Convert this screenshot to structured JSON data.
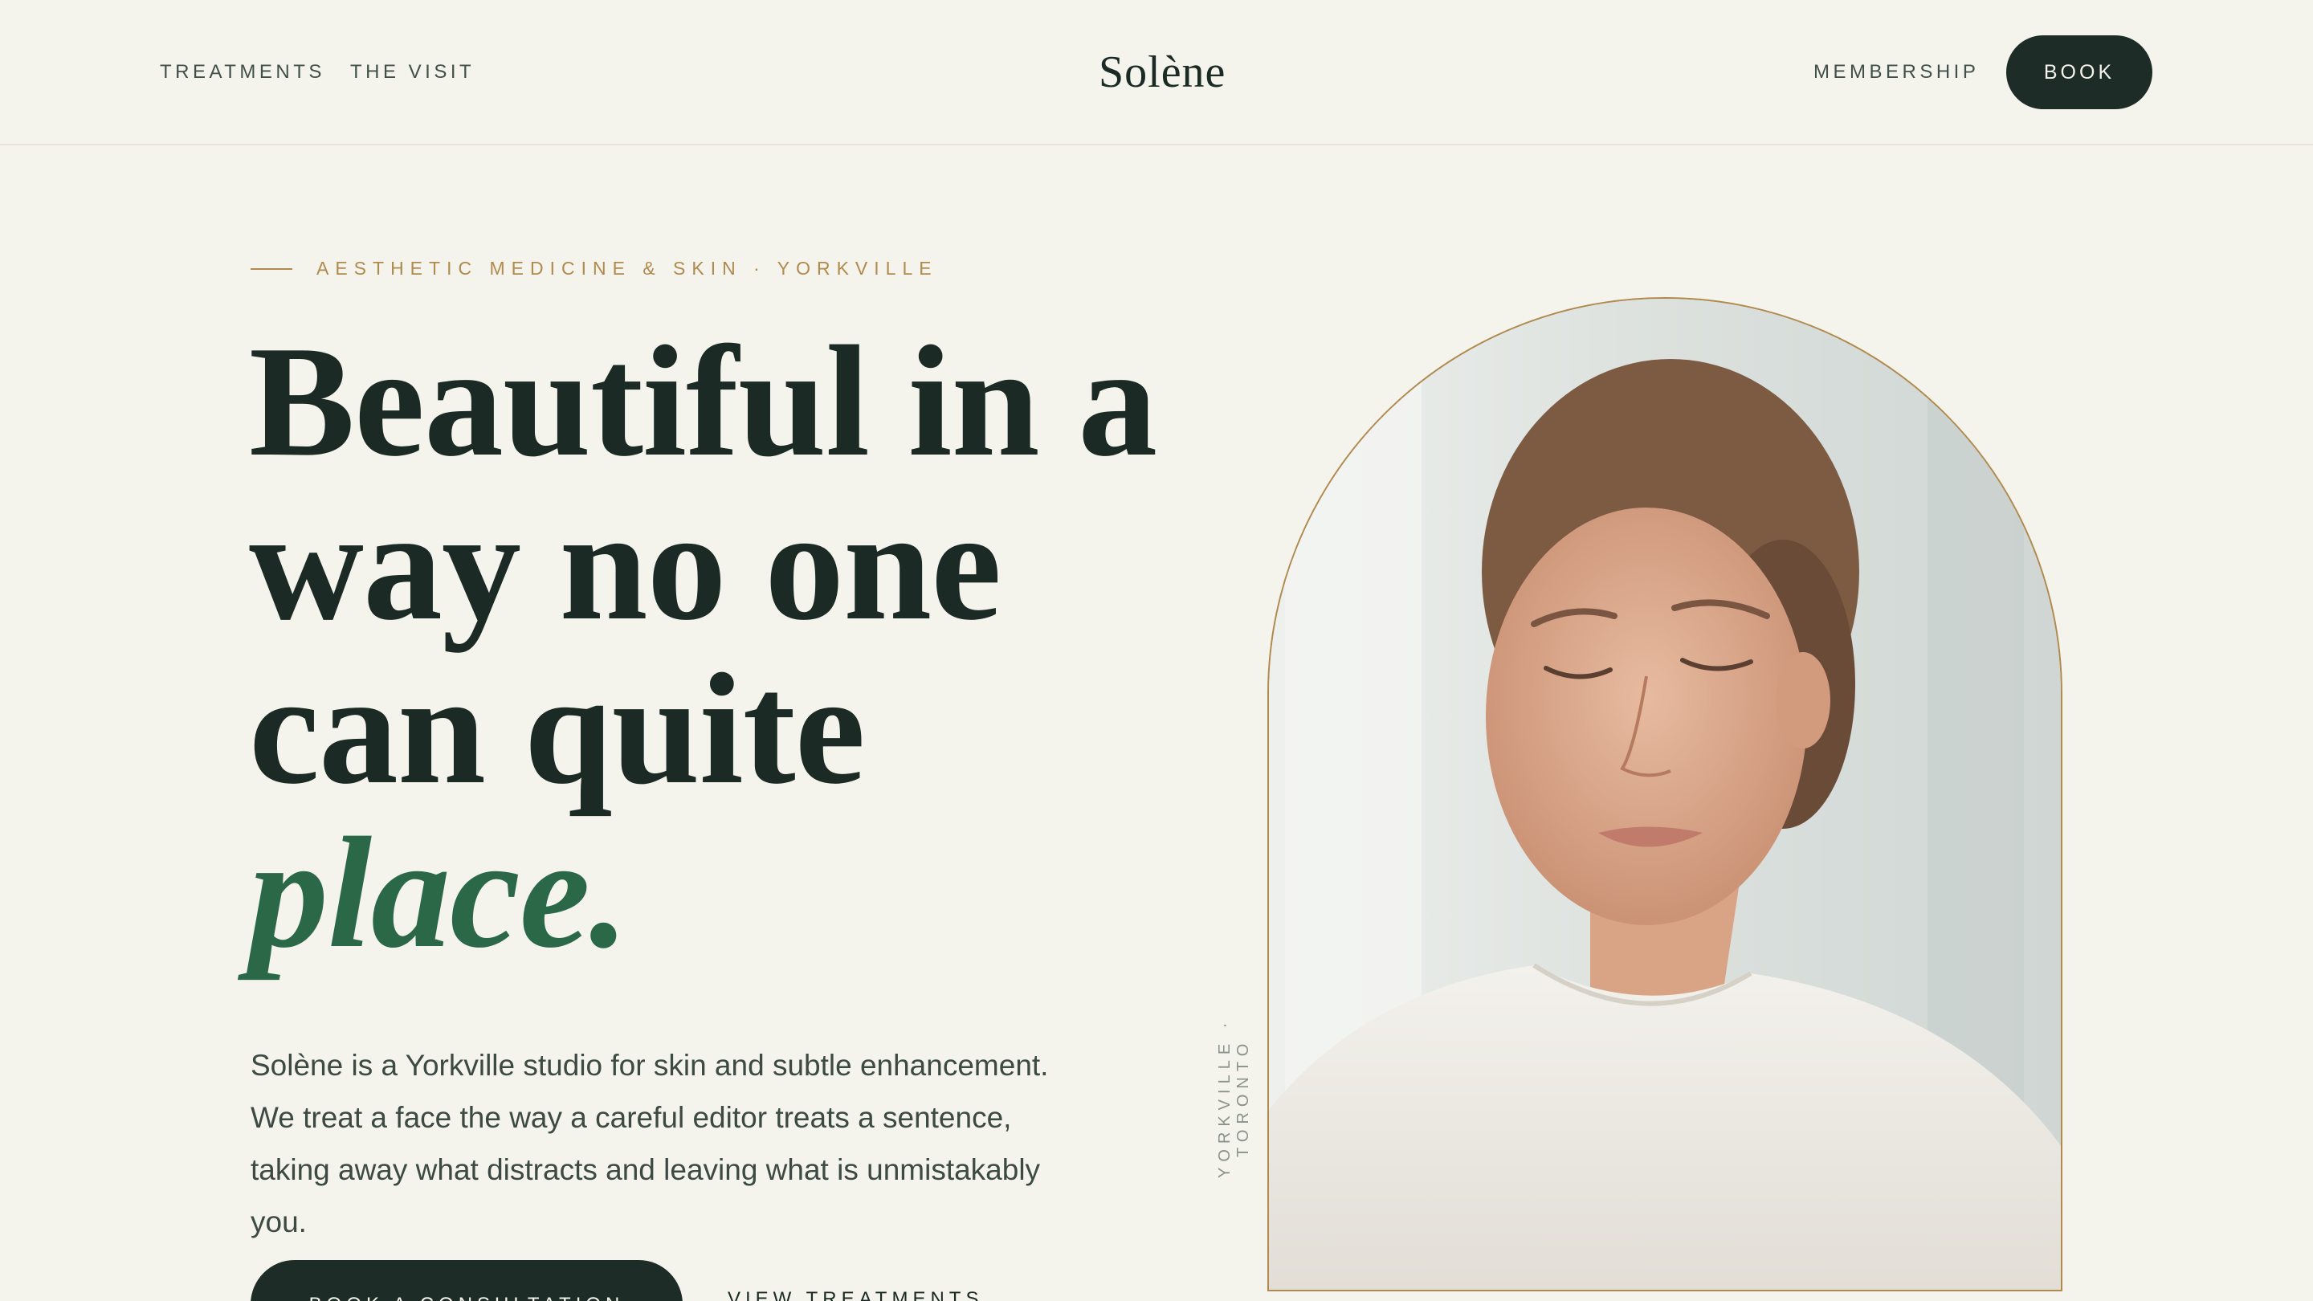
{
  "header": {
    "nav_left": [
      "TREATMENTS",
      "THE VISIT"
    ],
    "logo": "Solène",
    "nav_right": "MEMBERSHIP",
    "book_label": "BOOK"
  },
  "hero": {
    "eyebrow": "AESTHETIC MEDICINE & SKIN · YORKVILLE",
    "headline_lines": [
      "Beautiful in a",
      "way no one",
      "can quite"
    ],
    "headline_accent": "place.",
    "lede": "Solène is a Yorkville studio for skin and subtle enhancement. We treat a face the way a careful editor treats a sentence, taking away what distracts and leaving what is unmistakably you.",
    "cta_primary": "BOOK A CONSULTATION",
    "cta_secondary": "VIEW TREATMENTS",
    "vertical_caption": "YORKVILLE · TORONTO"
  },
  "colors": {
    "background": "#f4f3ec",
    "ink": "#1b2a24",
    "accent_green": "#2a6848",
    "gold": "#b08a4e",
    "button_dark": "#1d2c26"
  }
}
